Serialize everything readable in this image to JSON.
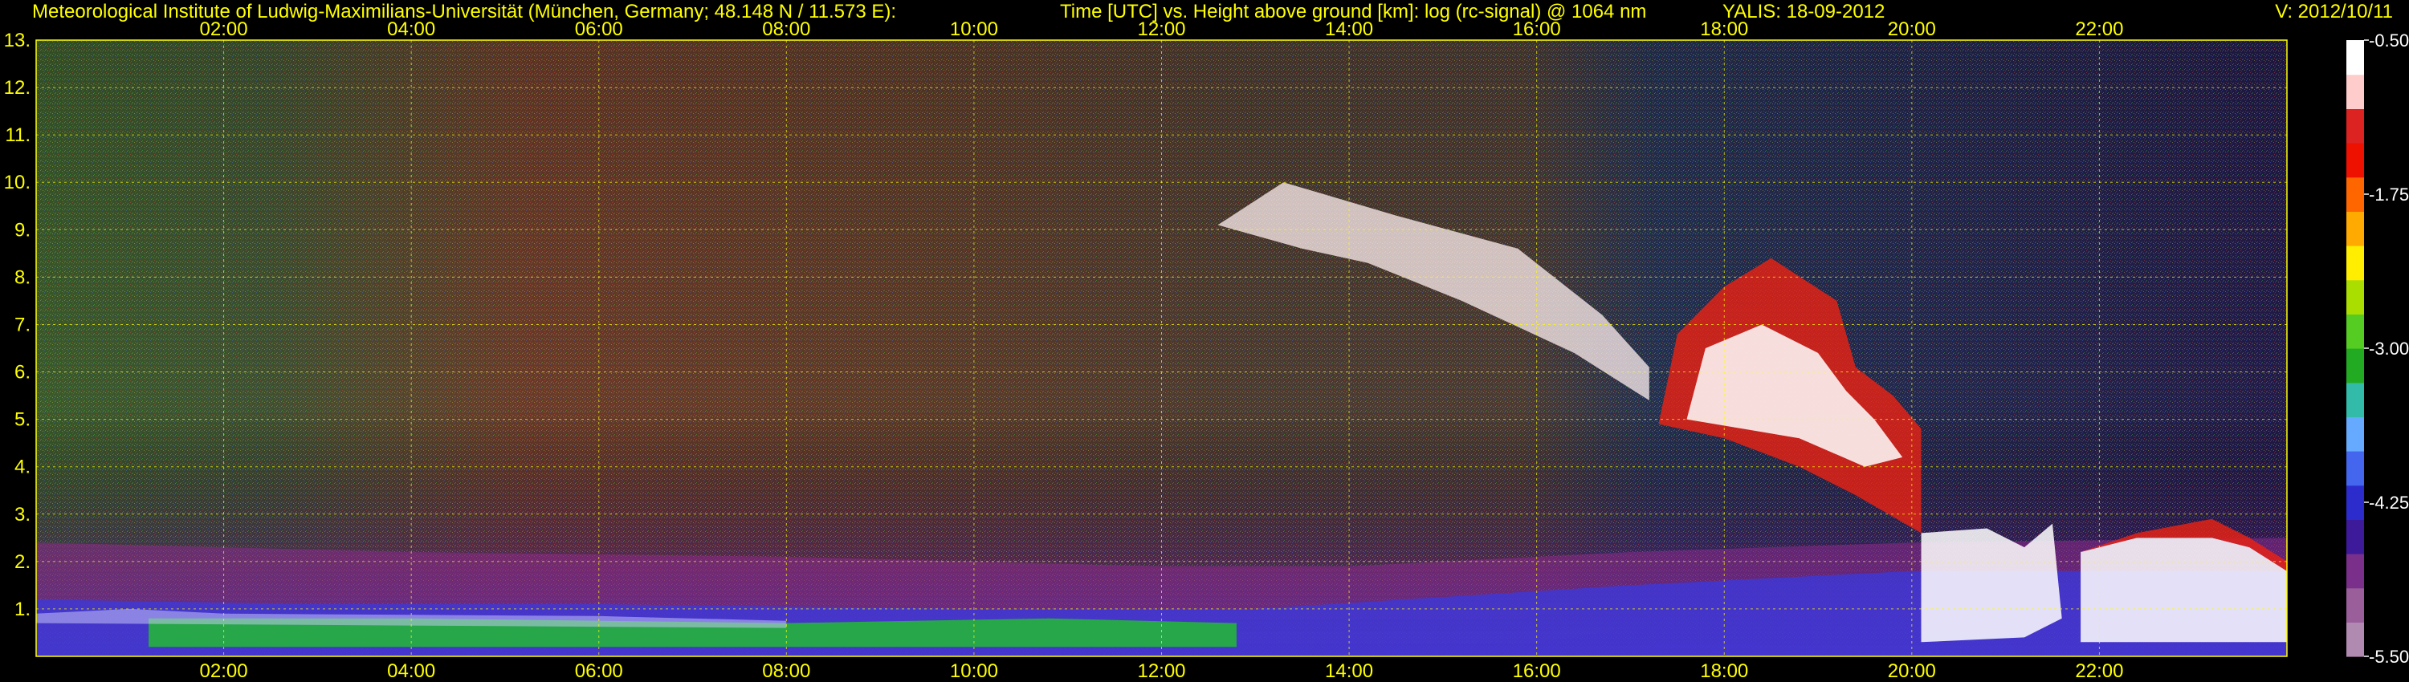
{
  "header": {
    "institute": "Meteorological Institute of Ludwig-Maximilians-Universität (München, Germany; 48.148 N / 11.573 E):",
    "title": "Time [UTC] vs. Height above ground [km]: log (rc-signal) @ 1064 nm",
    "station": "YALIS: 18-09-2012",
    "version": "V: 2012/10/11"
  },
  "chart_data": {
    "type": "heatmap",
    "title": "Time [UTC] vs. Height above ground [km]: log (rc-signal) @ 1064 nm",
    "xlabel": "",
    "ylabel": "",
    "x_ticks": [
      "02:00",
      "04:00",
      "06:00",
      "08:00",
      "10:00",
      "12:00",
      "14:00",
      "16:00",
      "18:00",
      "20:00",
      "22:00"
    ],
    "x_range_hours": [
      0,
      24
    ],
    "y_ticks": [
      "1.",
      "2.",
      "3.",
      "4.",
      "5.",
      "6.",
      "7.",
      "8.",
      "9.",
      "10.",
      "11.",
      "12.",
      "13."
    ],
    "y_range_km": [
      0,
      13
    ],
    "grid": true,
    "colorbar": {
      "ticks": [
        "-0.50",
        "-1.75",
        "-3.00",
        "-4.25",
        "-5.50"
      ],
      "range": [
        -5.5,
        -0.5
      ],
      "colors": [
        "#b08ab0",
        "#9a5e9a",
        "#7a2f8a",
        "#3d1a9a",
        "#2c2ccc",
        "#4466ee",
        "#66aaff",
        "#33bbaa",
        "#22aa22",
        "#55cc22",
        "#aadd00",
        "#ffee00",
        "#ffaa00",
        "#ff6600",
        "#ee1100",
        "#dd2222",
        "#ffcccc",
        "#ffffff"
      ]
    }
  }
}
